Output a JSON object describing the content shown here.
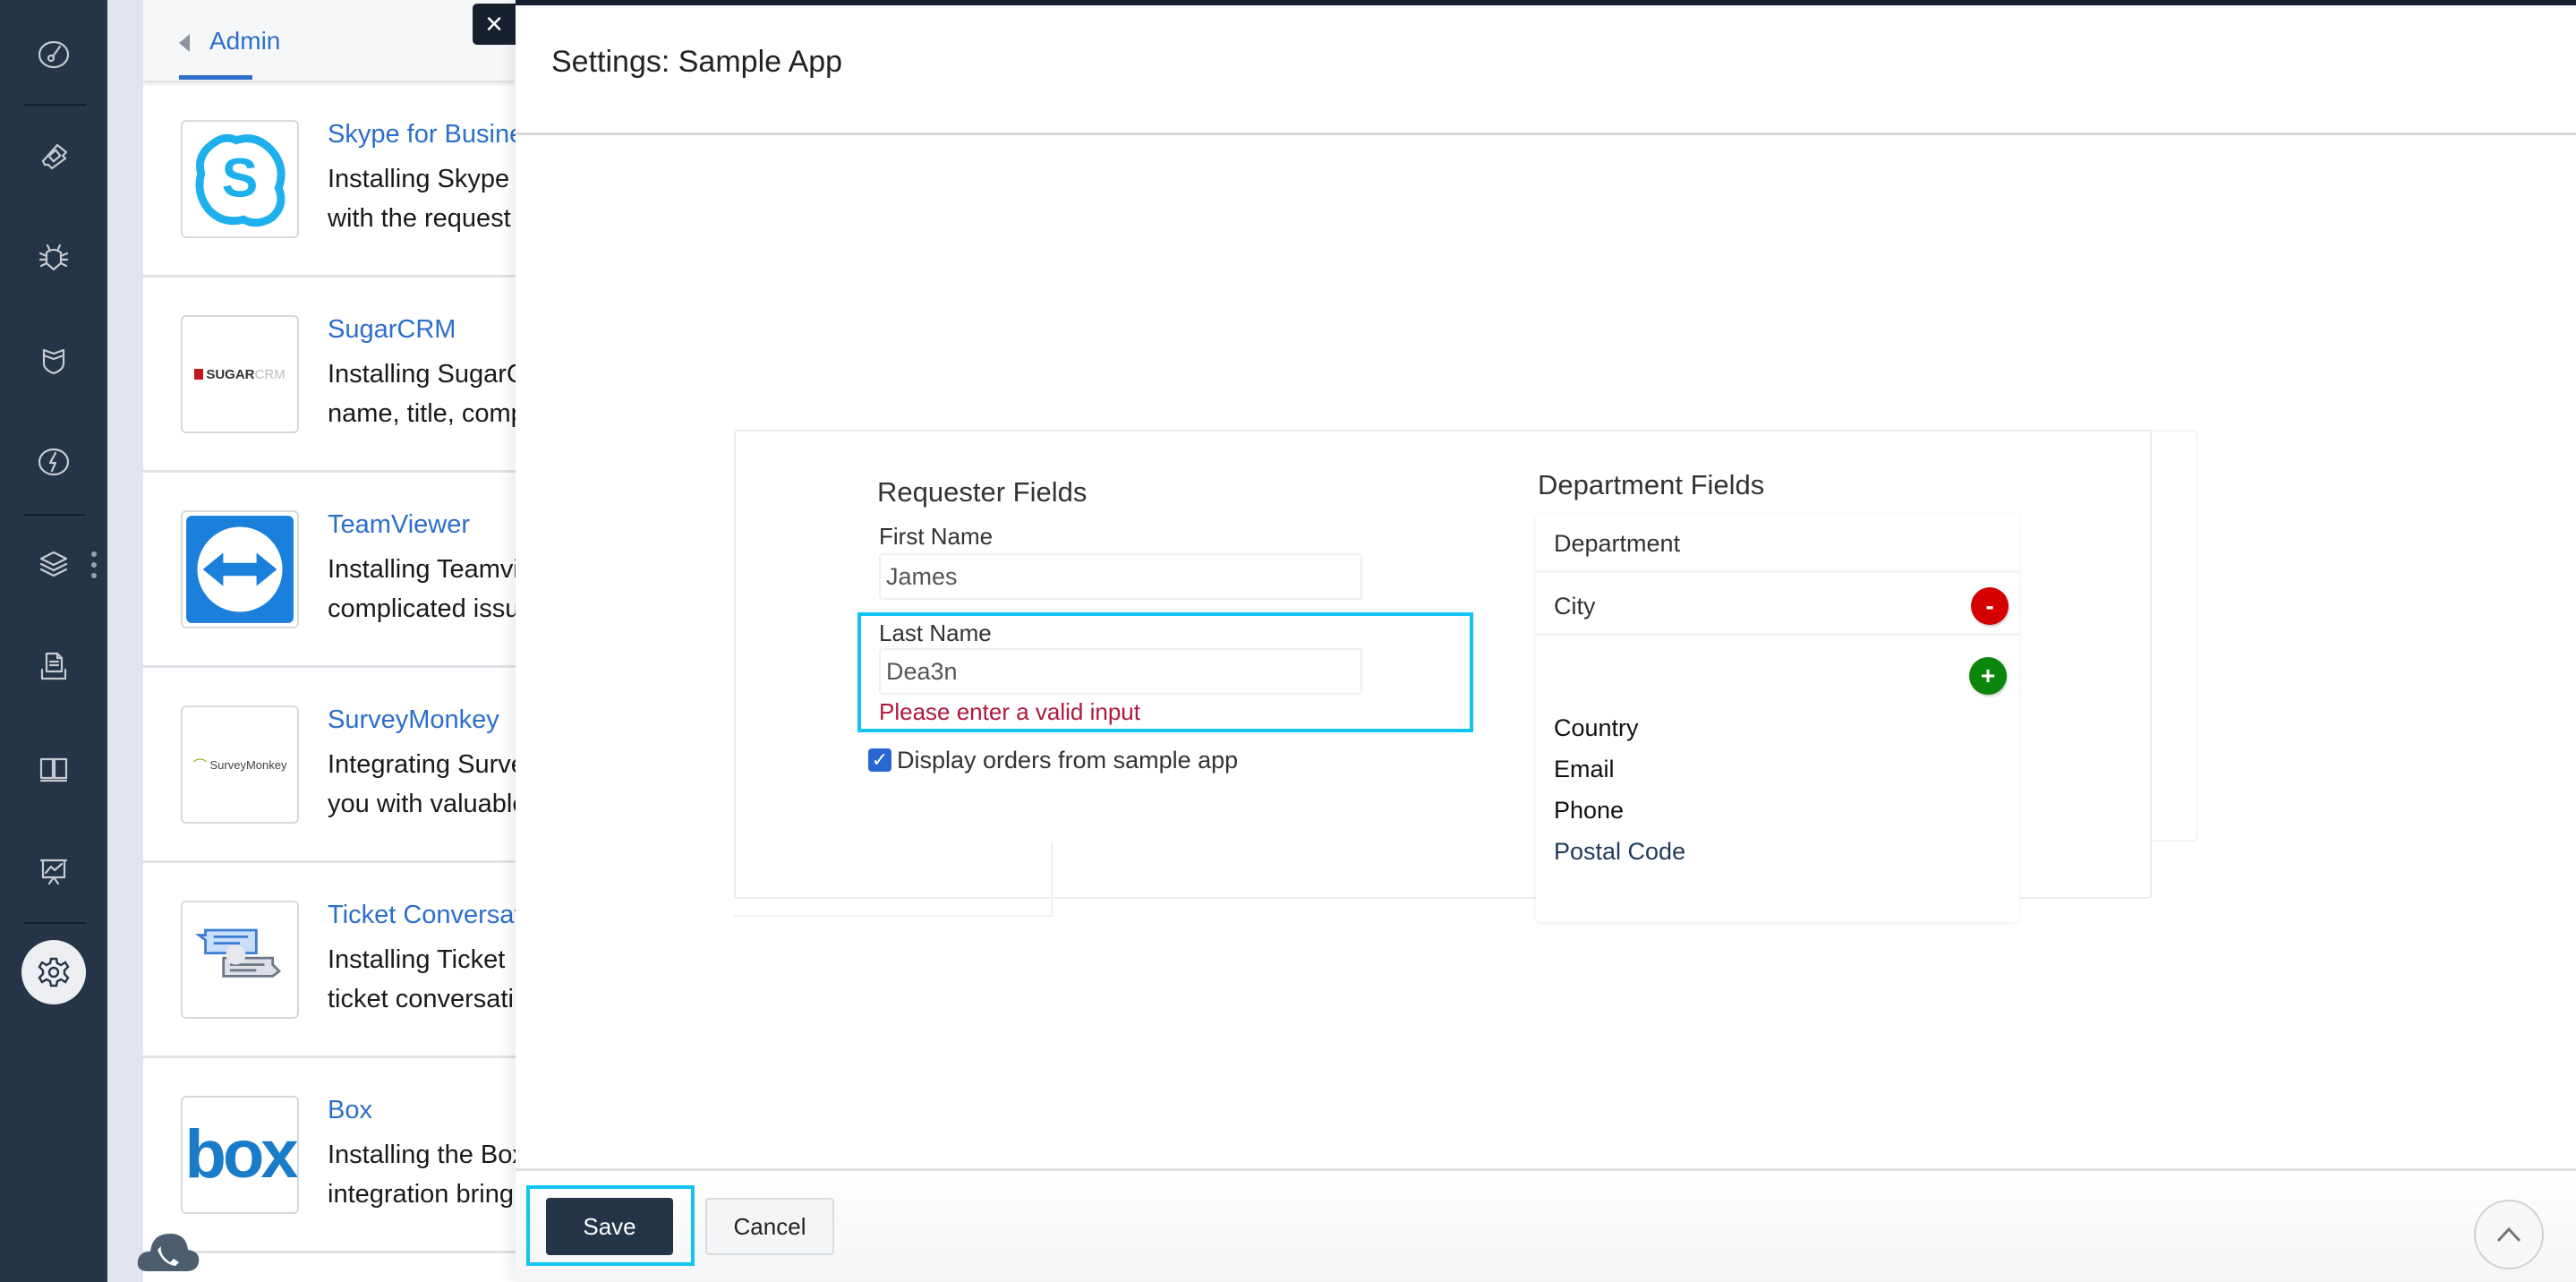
{
  "sidebar": {
    "icons": [
      "dashboard-icon",
      "tickets-icon",
      "problems-icon",
      "changes-icon",
      "releases-icon",
      "assets-icon",
      "solutions-icon",
      "knowledge-icon",
      "analytics-icon",
      "admin-gear-icon"
    ],
    "active": "admin-gear-icon"
  },
  "list_panel": {
    "back_label": "Admin",
    "apps": [
      {
        "name": "Skype for Business",
        "desc_line1": "Installing Skype",
        "desc_line2": "with the request",
        "logo": "skype-logo"
      },
      {
        "name": "SugarCRM",
        "desc_line1": "Installing SugarCRM",
        "desc_line2": "name, title, comp",
        "logo": "sugarcrm-logo",
        "logo_text_a": "SUGAR",
        "logo_text_b": "CRM"
      },
      {
        "name": "TeamViewer",
        "desc_line1": "Installing Teamviewer",
        "desc_line2": "complicated issu",
        "logo": "teamviewer-logo"
      },
      {
        "name": "SurveyMonkey",
        "desc_line1": "Integrating SurveyMonkey",
        "desc_line2": "you with valuable",
        "logo": "surveymonkey-logo",
        "logo_text": "SurveyMonkey"
      },
      {
        "name": "Ticket Conversations",
        "desc_line1": "Installing Ticket",
        "desc_line2": "ticket conversati",
        "logo": "ticket-conversations-logo"
      },
      {
        "name": "Box",
        "desc_line1": "Installing the Box",
        "desc_line2": "integration bring",
        "logo": "box-logo",
        "logo_text": "box"
      }
    ]
  },
  "modal": {
    "close_label": "×",
    "title": "Settings: Sample App",
    "requester": {
      "title": "Requester Fields",
      "first_name_label": "First Name",
      "first_name_value": "James",
      "last_name_label": "Last Name",
      "last_name_value": "Dea3n",
      "error": "Please enter a valid input",
      "checkbox_checked": true,
      "checkbox_label": "Display orders from sample app"
    },
    "department": {
      "title": "Department Fields",
      "rows": [
        "Department",
        "City"
      ],
      "remove_label": "-",
      "add_label": "+",
      "options": [
        "Country",
        "Email",
        "Phone",
        "Postal Code"
      ],
      "hovered_option": "Postal Code"
    },
    "footer": {
      "save_label": "Save",
      "cancel_label": "Cancel"
    }
  },
  "colors": {
    "sidebar": "#253447",
    "link": "#2c6ecb",
    "highlight": "#11c5f1",
    "error": "#b0173c",
    "remove": "#d50000",
    "add": "#0a870a"
  }
}
